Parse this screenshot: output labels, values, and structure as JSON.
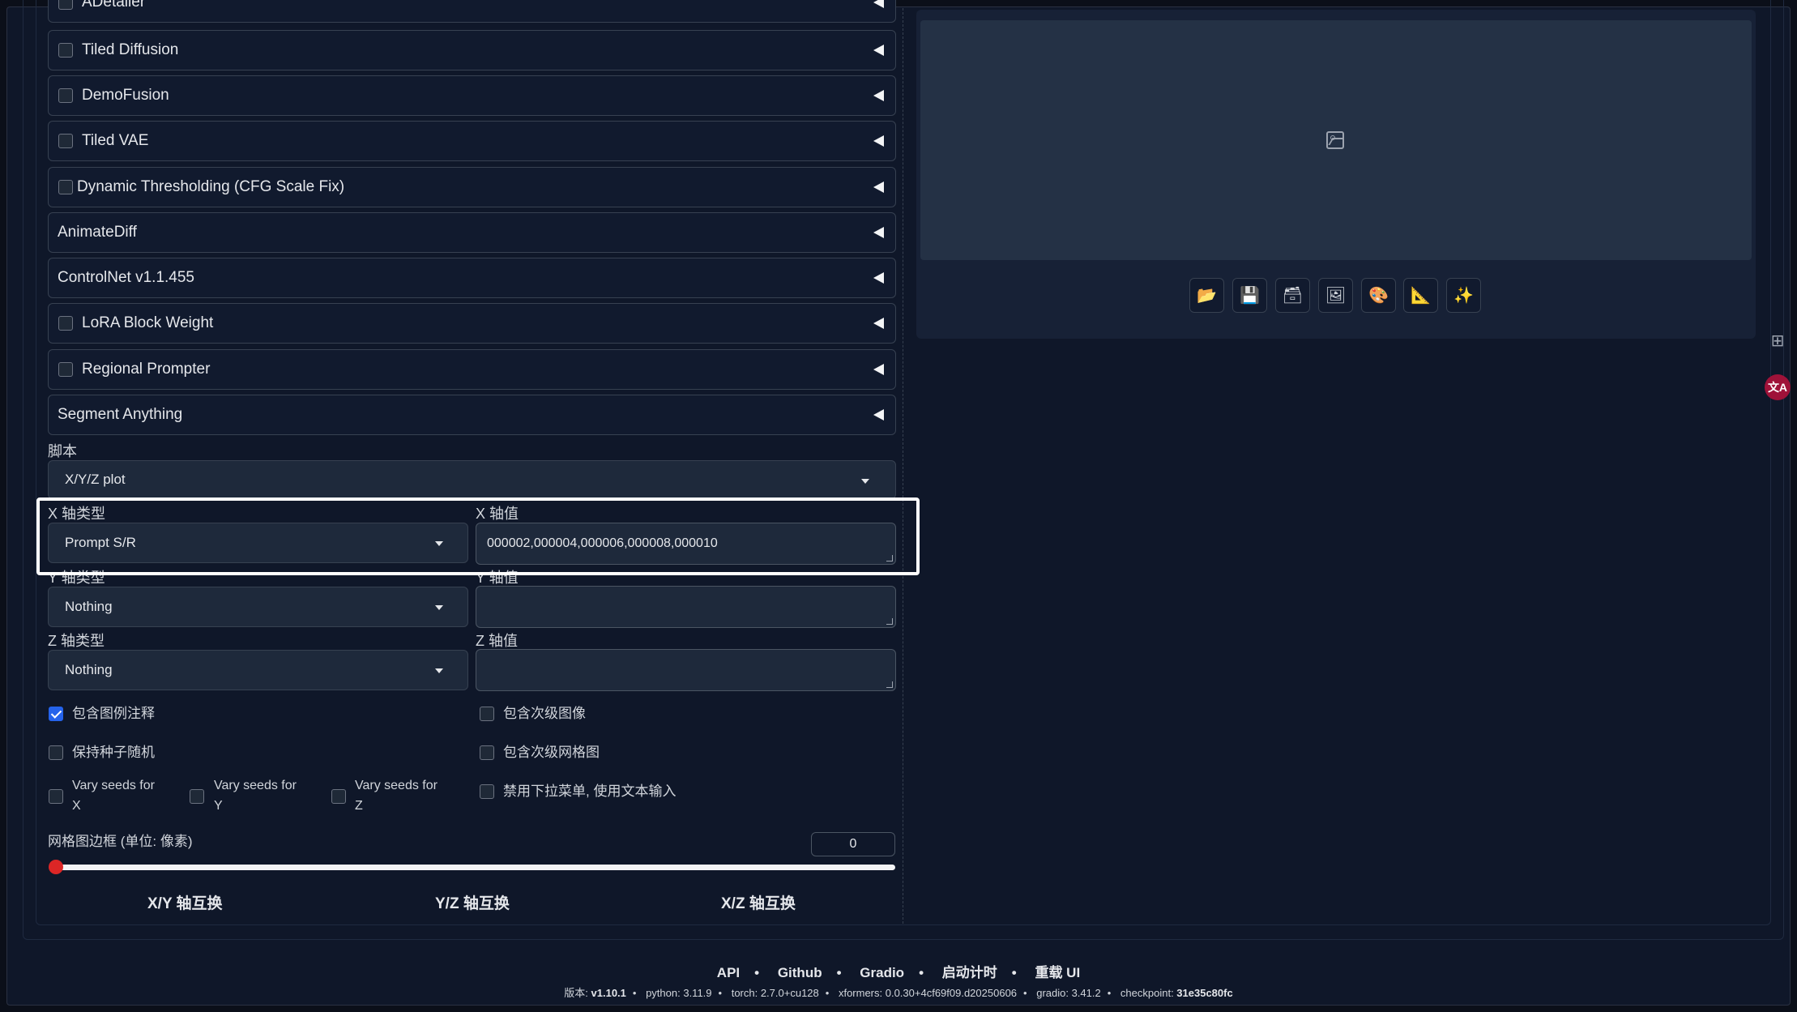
{
  "accordions": [
    {
      "label": "ADetailer",
      "checkbox": true
    },
    {
      "label": "Tiled Diffusion",
      "checkbox": true
    },
    {
      "label": "DemoFusion",
      "checkbox": true
    },
    {
      "label": "Tiled VAE",
      "checkbox": true
    },
    {
      "label": "Dynamic Thresholding (CFG Scale Fix)",
      "checkbox": true
    },
    {
      "label": "AnimateDiff",
      "checkbox": false
    },
    {
      "label": "ControlNet v1.1.455",
      "checkbox": false
    },
    {
      "label": "LoRA Block Weight",
      "checkbox": true
    },
    {
      "label": "Regional Prompter",
      "checkbox": true
    },
    {
      "label": "Segment Anything",
      "checkbox": false
    }
  ],
  "script": {
    "label": "脚本",
    "value": "X/Y/Z plot"
  },
  "axes": {
    "x_type_label": "X 轴类型",
    "x_type_value": "Prompt S/R",
    "x_values_label": "X 轴值",
    "x_values_value": "000002,000004,000006,000008,000010",
    "y_type_label": "Y 轴类型",
    "y_type_value": "Nothing",
    "y_values_label": "Y 轴值",
    "y_values_value": "",
    "z_type_label": "Z 轴类型",
    "z_type_value": "Nothing",
    "z_values_label": "Z 轴值",
    "z_values_value": ""
  },
  "options": {
    "include_legend": {
      "label": "包含图例注释",
      "checked": true
    },
    "include_sub_images": {
      "label": "包含次级图像",
      "checked": false
    },
    "keep_seed_random": {
      "label": "保持种子随机",
      "checked": false
    },
    "include_sub_grids": {
      "label": "包含次级网格图",
      "checked": false
    },
    "vary_x": {
      "label_line1": "Vary seeds for",
      "label_line2": "X",
      "checked": false
    },
    "vary_y": {
      "label_line1": "Vary seeds for",
      "label_line2": "Y",
      "checked": false
    },
    "vary_z": {
      "label_line1": "Vary seeds for",
      "label_line2": "Z",
      "checked": false
    },
    "disable_dropdown": {
      "label": "禁用下拉菜单, 使用文本输入",
      "checked": false
    }
  },
  "grid_margin": {
    "label": "网格图边框 (单位: 像素)",
    "value": "0",
    "slider_fraction": 0
  },
  "swap_buttons": {
    "xy": "X/Y 轴互换",
    "yz": "Y/Z 轴互换",
    "xz": "X/Z 轴互换"
  },
  "toolbar_icons": [
    "folder-icon",
    "save-icon",
    "zip-icon",
    "image-icon",
    "palette-icon",
    "ruler-icon",
    "sparkles-icon"
  ],
  "toolbar_glyphs": [
    "📂",
    "💾",
    "🗃",
    "🖼",
    "🎨",
    "📐",
    "✨"
  ],
  "side_icons": {
    "translate_label": "文A"
  },
  "footer": {
    "links": [
      "API",
      "Github",
      "Gradio",
      "启动计时",
      "重载 UI"
    ],
    "version_label": "版本: ",
    "version": "v1.10.1",
    "python": "python: 3.11.9",
    "torch": "torch: 2.7.0+cu128",
    "xformers": "xformers: 0.0.30+4cf69f09.d20250606",
    "gradio": "gradio: 3.41.2",
    "checkpoint_label": "checkpoint: ",
    "checkpoint": "31e35c80fc"
  }
}
